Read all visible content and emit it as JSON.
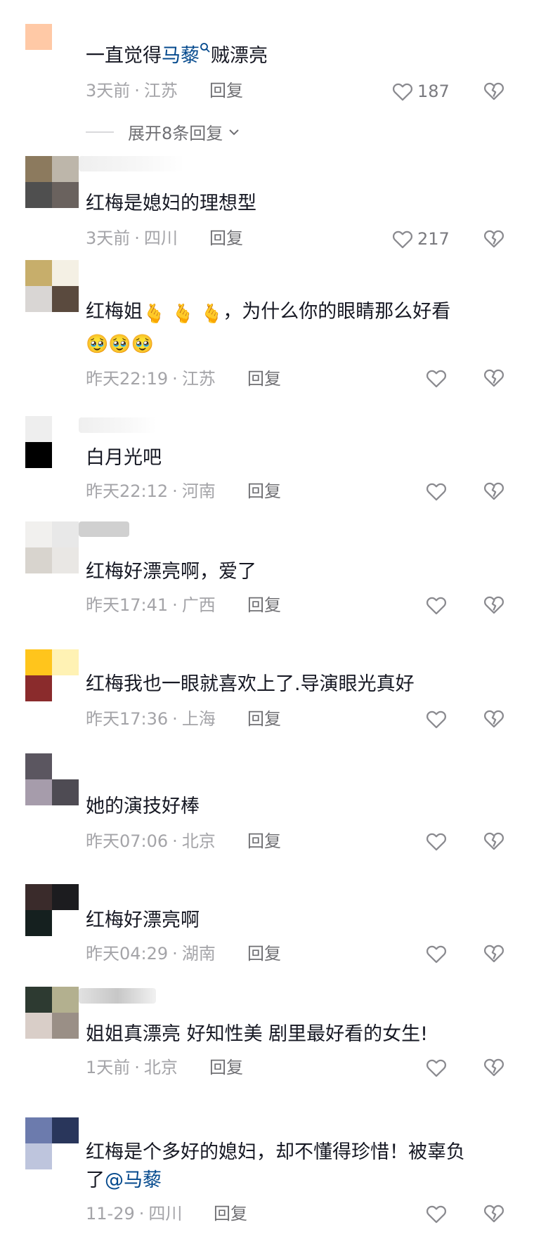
{
  "comments": [
    {
      "avatar_colors": [
        "#ffc9a6",
        "#ffffff",
        "#ffffff",
        "#ffffff"
      ],
      "text_parts": [
        "一直觉得",
        "马藜",
        "贼漂亮"
      ],
      "time": "3天前",
      "location": "江苏",
      "reply": "回复",
      "likes": "187",
      "expand_text": "展开8条回复"
    },
    {
      "avatar_colors": [
        "#8c7a5e",
        "#bdb6aa",
        "#4f4f4f",
        "#6a625e"
      ],
      "text": "红梅是媳妇的理想型",
      "time": "3天前",
      "location": "四川",
      "reply": "回复",
      "likes": "217"
    },
    {
      "avatar_colors": [
        "#c7ae6b",
        "#f4f0e4",
        "#d9d6d4",
        "#5a4a3e"
      ],
      "text_line1": "红梅姐",
      "emoji_hands": "🫰",
      "text_line1_tail": "，为什么你的眼睛那么好看",
      "emoji_face": "🥹",
      "time": "昨天22:19",
      "location": "江苏",
      "reply": "回复",
      "likes": ""
    },
    {
      "avatar_colors": [
        "#eeeeee",
        "#ffffff",
        "#000000",
        "#ffffff"
      ],
      "text": "白月光吧",
      "time": "昨天22:12",
      "location": "河南",
      "reply": "回复",
      "likes": ""
    },
    {
      "avatar_colors": [
        "#f1f0ee",
        "#e8e8e8",
        "#d8d4ce",
        "#e9e7e4"
      ],
      "text": "红梅好漂亮啊，爱了",
      "time": "昨天17:41",
      "location": "广西",
      "reply": "回复",
      "likes": ""
    },
    {
      "avatar_colors": [
        "#ffc51c",
        "#fff2b4",
        "#8a2b2c",
        "#ffffff"
      ],
      "text": "红梅我也一眼就喜欢上了.导演眼光真好",
      "time": "昨天17:36",
      "location": "上海",
      "reply": "回复",
      "likes": ""
    },
    {
      "avatar_colors": [
        "#5b5660",
        "#ffffff",
        "#a69cab",
        "#4e4b53"
      ],
      "text": "她的演技好棒",
      "time": "昨天07:06",
      "location": "北京",
      "reply": "回复",
      "likes": ""
    },
    {
      "avatar_colors": [
        "#3a2b2b",
        "#1c1c1f",
        "#15201f",
        "#ffffff"
      ],
      "text": "红梅好漂亮啊",
      "time": "昨天04:29",
      "location": "湖南",
      "reply": "回复",
      "likes": ""
    },
    {
      "avatar_colors": [
        "#2d3a31",
        "#b3b08f",
        "#d9cec8",
        "#9a8f86"
      ],
      "text": "姐姐真漂亮 好知性美 剧里最好看的女生!",
      "time": "1天前",
      "location": "北京",
      "reply": "回复",
      "likes": ""
    },
    {
      "avatar_colors": [
        "#6c7bad",
        "#29365b",
        "#bec5dd",
        "#ffffff"
      ],
      "text_line1": "红梅是个多好的媳妇，却不懂得珍惜！被辜负",
      "text_line2_prefix": "了",
      "text_line2_mention": "@马藜",
      "time": "11-29",
      "location": "四川",
      "reply": "回复",
      "likes": ""
    }
  ],
  "colors": {
    "text": "#161823",
    "meta": "#a4a4a8",
    "reply": "#6f6f73",
    "link": "#04498d",
    "icon": "#8a8a8f"
  },
  "icons": {
    "like": "heart-outline-icon",
    "dislike": "broken-heart-icon",
    "search_hint": "search-icon",
    "expand": "chevron-down-icon"
  }
}
